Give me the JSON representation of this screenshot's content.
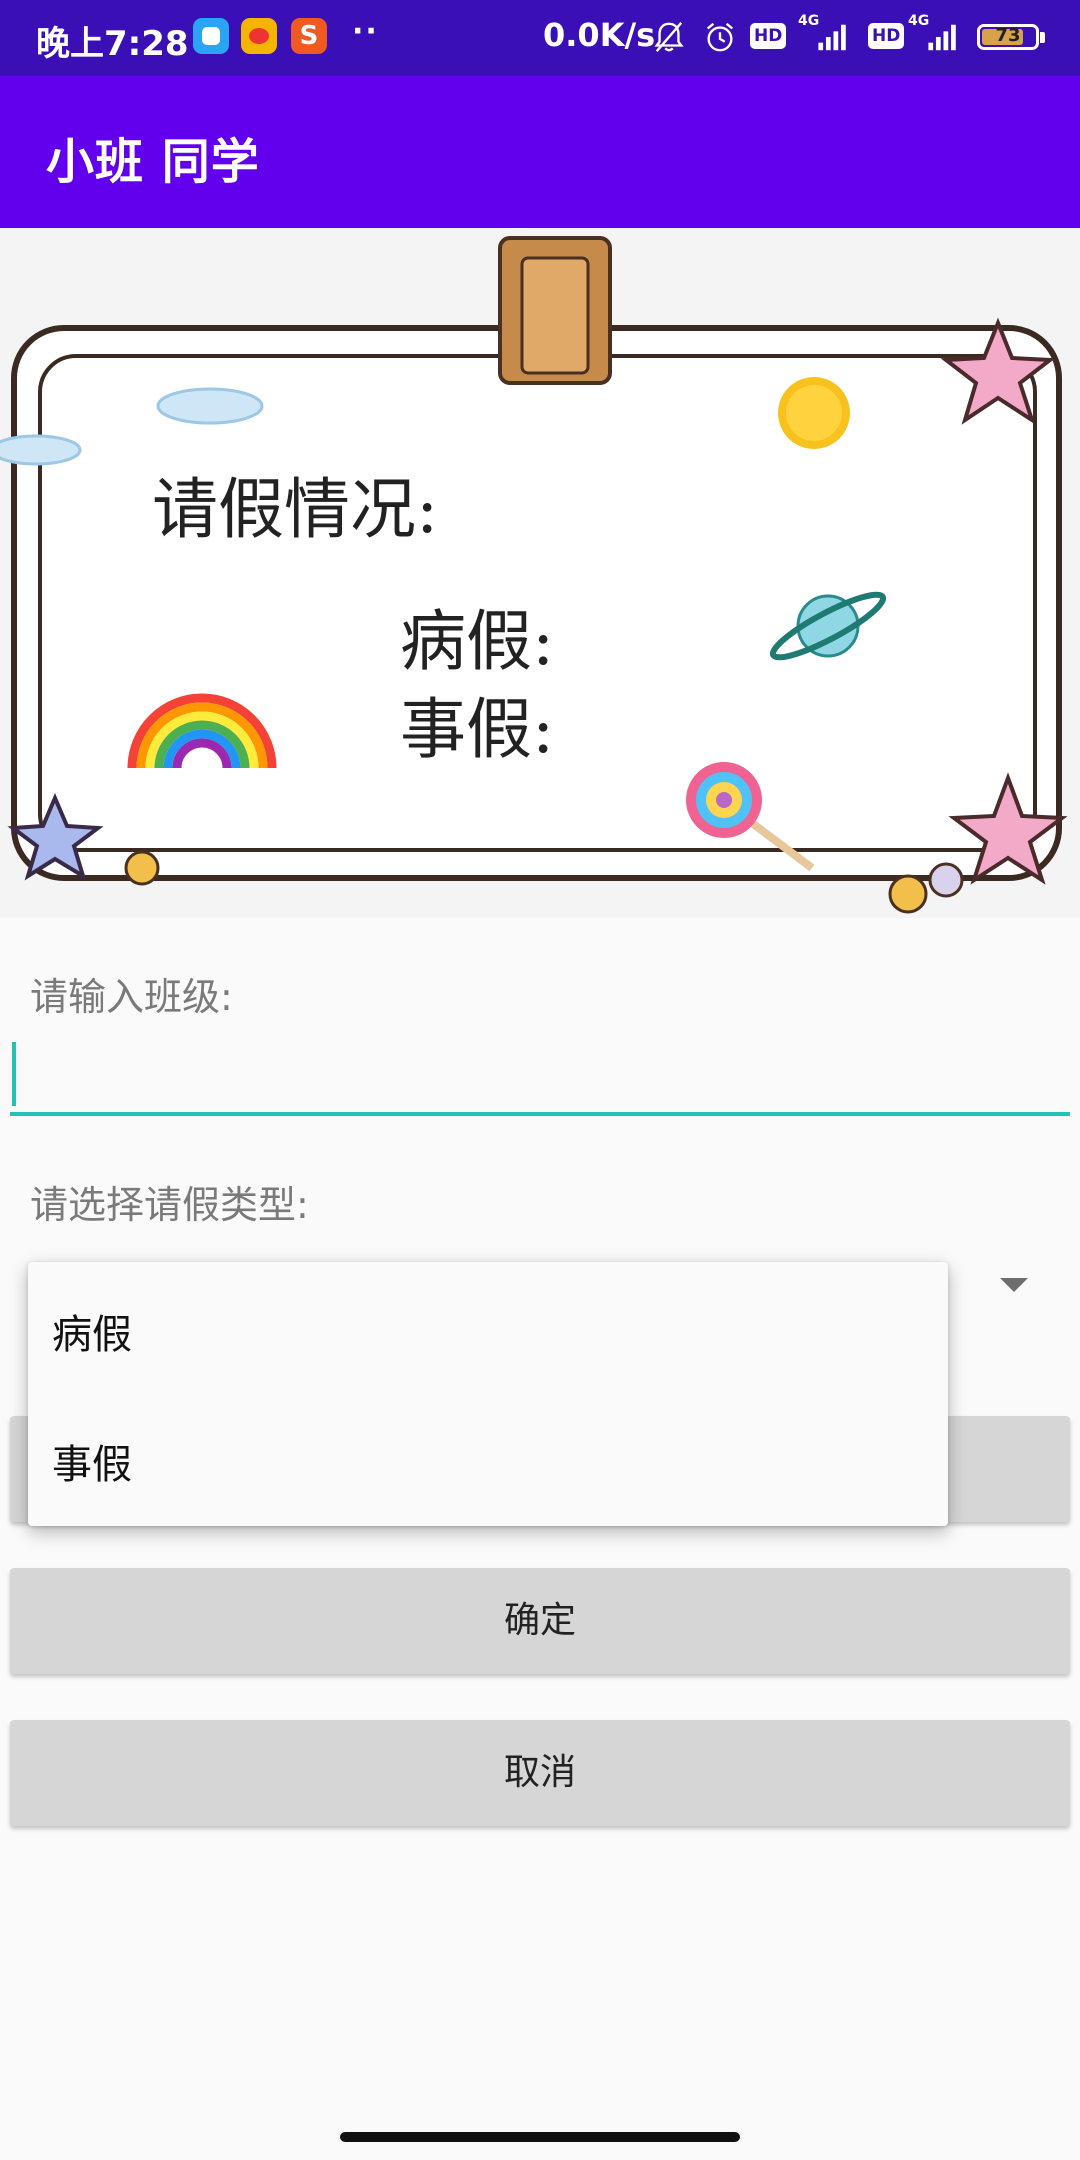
{
  "status_bar": {
    "time": "晚上7:28",
    "more_dots": "··",
    "net_speed": "0.0K/s",
    "sogou_letter": "S",
    "hd_badge": "HD",
    "network": "4G",
    "battery": "73"
  },
  "app_bar": {
    "title": "小班 同学"
  },
  "banner": {
    "heading": "请假情况:",
    "line_sick": "病假:",
    "line_personal": "事假:"
  },
  "form": {
    "class_label": "请输入班级:",
    "class_value": "",
    "type_label": "请选择请假类型:",
    "confirm": "确定",
    "cancel": "取消"
  },
  "dropdown": {
    "options": [
      "病假",
      "事假"
    ]
  },
  "colors": {
    "status_bar": "#3a10b6",
    "app_bar": "#6200ee",
    "input_accent": "#1fc4b4",
    "button": "#d6d6d6"
  }
}
